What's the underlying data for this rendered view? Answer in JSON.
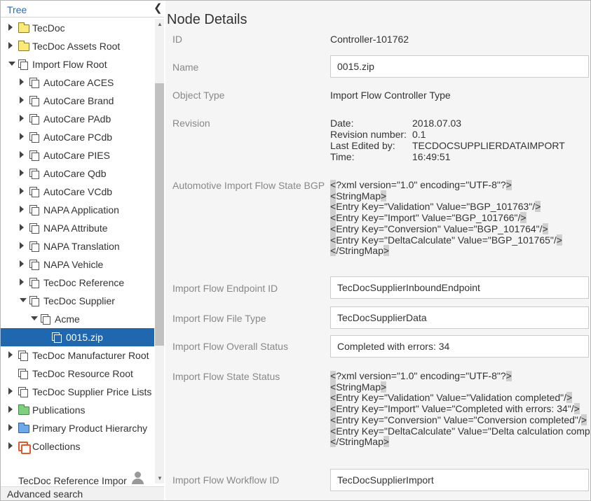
{
  "tree": {
    "header_label": "Tree",
    "items": [
      {
        "label": "TecDoc",
        "indent": 0,
        "toggle": "closed",
        "icon": "folder-yellow-icon"
      },
      {
        "label": "TecDoc Assets Root",
        "indent": 0,
        "toggle": "closed",
        "icon": "folder-yellow-icon"
      },
      {
        "label": "Import Flow Root",
        "indent": 0,
        "toggle": "open",
        "icon": "pages-icon"
      },
      {
        "label": "AutoCare ACES",
        "indent": 1,
        "toggle": "closed",
        "icon": "pages-icon"
      },
      {
        "label": "AutoCare Brand",
        "indent": 1,
        "toggle": "closed",
        "icon": "pages-icon"
      },
      {
        "label": "AutoCare PAdb",
        "indent": 1,
        "toggle": "closed",
        "icon": "pages-icon"
      },
      {
        "label": "AutoCare PCdb",
        "indent": 1,
        "toggle": "closed",
        "icon": "pages-icon"
      },
      {
        "label": "AutoCare PIES",
        "indent": 1,
        "toggle": "closed",
        "icon": "pages-icon"
      },
      {
        "label": "AutoCare Qdb",
        "indent": 1,
        "toggle": "closed",
        "icon": "pages-icon"
      },
      {
        "label": "AutoCare VCdb",
        "indent": 1,
        "toggle": "closed",
        "icon": "pages-icon"
      },
      {
        "label": "NAPA Application",
        "indent": 1,
        "toggle": "closed",
        "icon": "pages-icon"
      },
      {
        "label": "NAPA Attribute",
        "indent": 1,
        "toggle": "closed",
        "icon": "pages-icon"
      },
      {
        "label": "NAPA Translation",
        "indent": 1,
        "toggle": "closed",
        "icon": "pages-icon"
      },
      {
        "label": "NAPA Vehicle",
        "indent": 1,
        "toggle": "closed",
        "icon": "pages-icon"
      },
      {
        "label": "TecDoc Reference",
        "indent": 1,
        "toggle": "closed",
        "icon": "pages-icon"
      },
      {
        "label": "TecDoc Supplier",
        "indent": 1,
        "toggle": "open",
        "icon": "pages-icon"
      },
      {
        "label": "Acme",
        "indent": 2,
        "toggle": "open",
        "icon": "pages-icon"
      },
      {
        "label": "0015.zip",
        "indent": 3,
        "toggle": "none",
        "icon": "pages-icon",
        "selected": true
      },
      {
        "label": "TecDoc Manufacturer Root",
        "indent": 0,
        "toggle": "closed",
        "icon": "pages-icon"
      },
      {
        "label": "TecDoc Resource Root",
        "indent": 0,
        "toggle": "none",
        "icon": "pages-icon"
      },
      {
        "label": "TecDoc Supplier Price Lists",
        "indent": 0,
        "toggle": "closed",
        "icon": "pages-icon"
      },
      {
        "label": "Publications",
        "indent": 0,
        "toggle": "closed",
        "icon": "folder-green-icon"
      },
      {
        "label": "Primary Product Hierarchy",
        "indent": 0,
        "toggle": "closed",
        "icon": "folder-blue-icon"
      },
      {
        "label": "Collections",
        "indent": 0,
        "toggle": "closed",
        "icon": "collections-icon"
      }
    ],
    "status_label": "TecDoc Reference Impor",
    "advanced_search": "Advanced search"
  },
  "details": {
    "title": "Node Details",
    "id_label": "ID",
    "id_value": "Controller-101762",
    "name_label": "Name",
    "name_value": "0015.zip",
    "object_type_label": "Object Type",
    "object_type_value": "Import Flow Controller Type",
    "revision_label": "Revision",
    "revision": {
      "date_key": "Date:",
      "date_val": "2018.07.03",
      "num_key": "Revision number:",
      "num_val": "0.1",
      "edited_key": "Last Edited by:",
      "edited_val": "TECDOCSUPPLIERDATAIMPORT",
      "time_key": "Time:",
      "time_val": "16:49:51"
    },
    "state_bgp_label": "Automotive Import Flow State BGP",
    "state_bgp_lines": [
      "<?xml version=\"1.0\" encoding=\"UTF-8\"?>",
      "<StringMap>",
      "<Entry Key=\"Validation\" Value=\"BGP_101763\"/>",
      "<Entry Key=\"Import\" Value=\"BGP_101766\"/>",
      "<Entry Key=\"Conversion\" Value=\"BGP_101764\"/>",
      "<Entry Key=\"DeltaCalculate\" Value=\"BGP_101765\"/>",
      "</StringMap>"
    ],
    "endpoint_label": "Import Flow Endpoint ID",
    "endpoint_value": "TecDocSupplierInboundEndpoint",
    "file_type_label": "Import Flow File Type",
    "file_type_value": "TecDocSupplierData",
    "overall_status_label": "Import Flow Overall Status",
    "overall_status_value": "Completed with errors: 34",
    "state_status_label": "Import Flow State Status",
    "state_status_lines": [
      "<?xml version=\"1.0\" encoding=\"UTF-8\"?>",
      "<StringMap>",
      "<Entry Key=\"Validation\" Value=\"Validation completed\"/>",
      "<Entry Key=\"Import\" Value=\"Completed with errors: 34\"/>",
      "<Entry Key=\"Conversion\" Value=\"Conversion completed\"/>",
      "<Entry Key=\"DeltaCalculate\" Value=\"Delta calculation completed\"/>",
      "</StringMap>"
    ],
    "workflow_label": "Import Flow Workflow ID",
    "workflow_value": "TecDocSupplierImport"
  },
  "colors": {
    "accent": "#2b6fb6",
    "selection": "#1f68af",
    "xml_highlight": "#cfcfcf"
  }
}
